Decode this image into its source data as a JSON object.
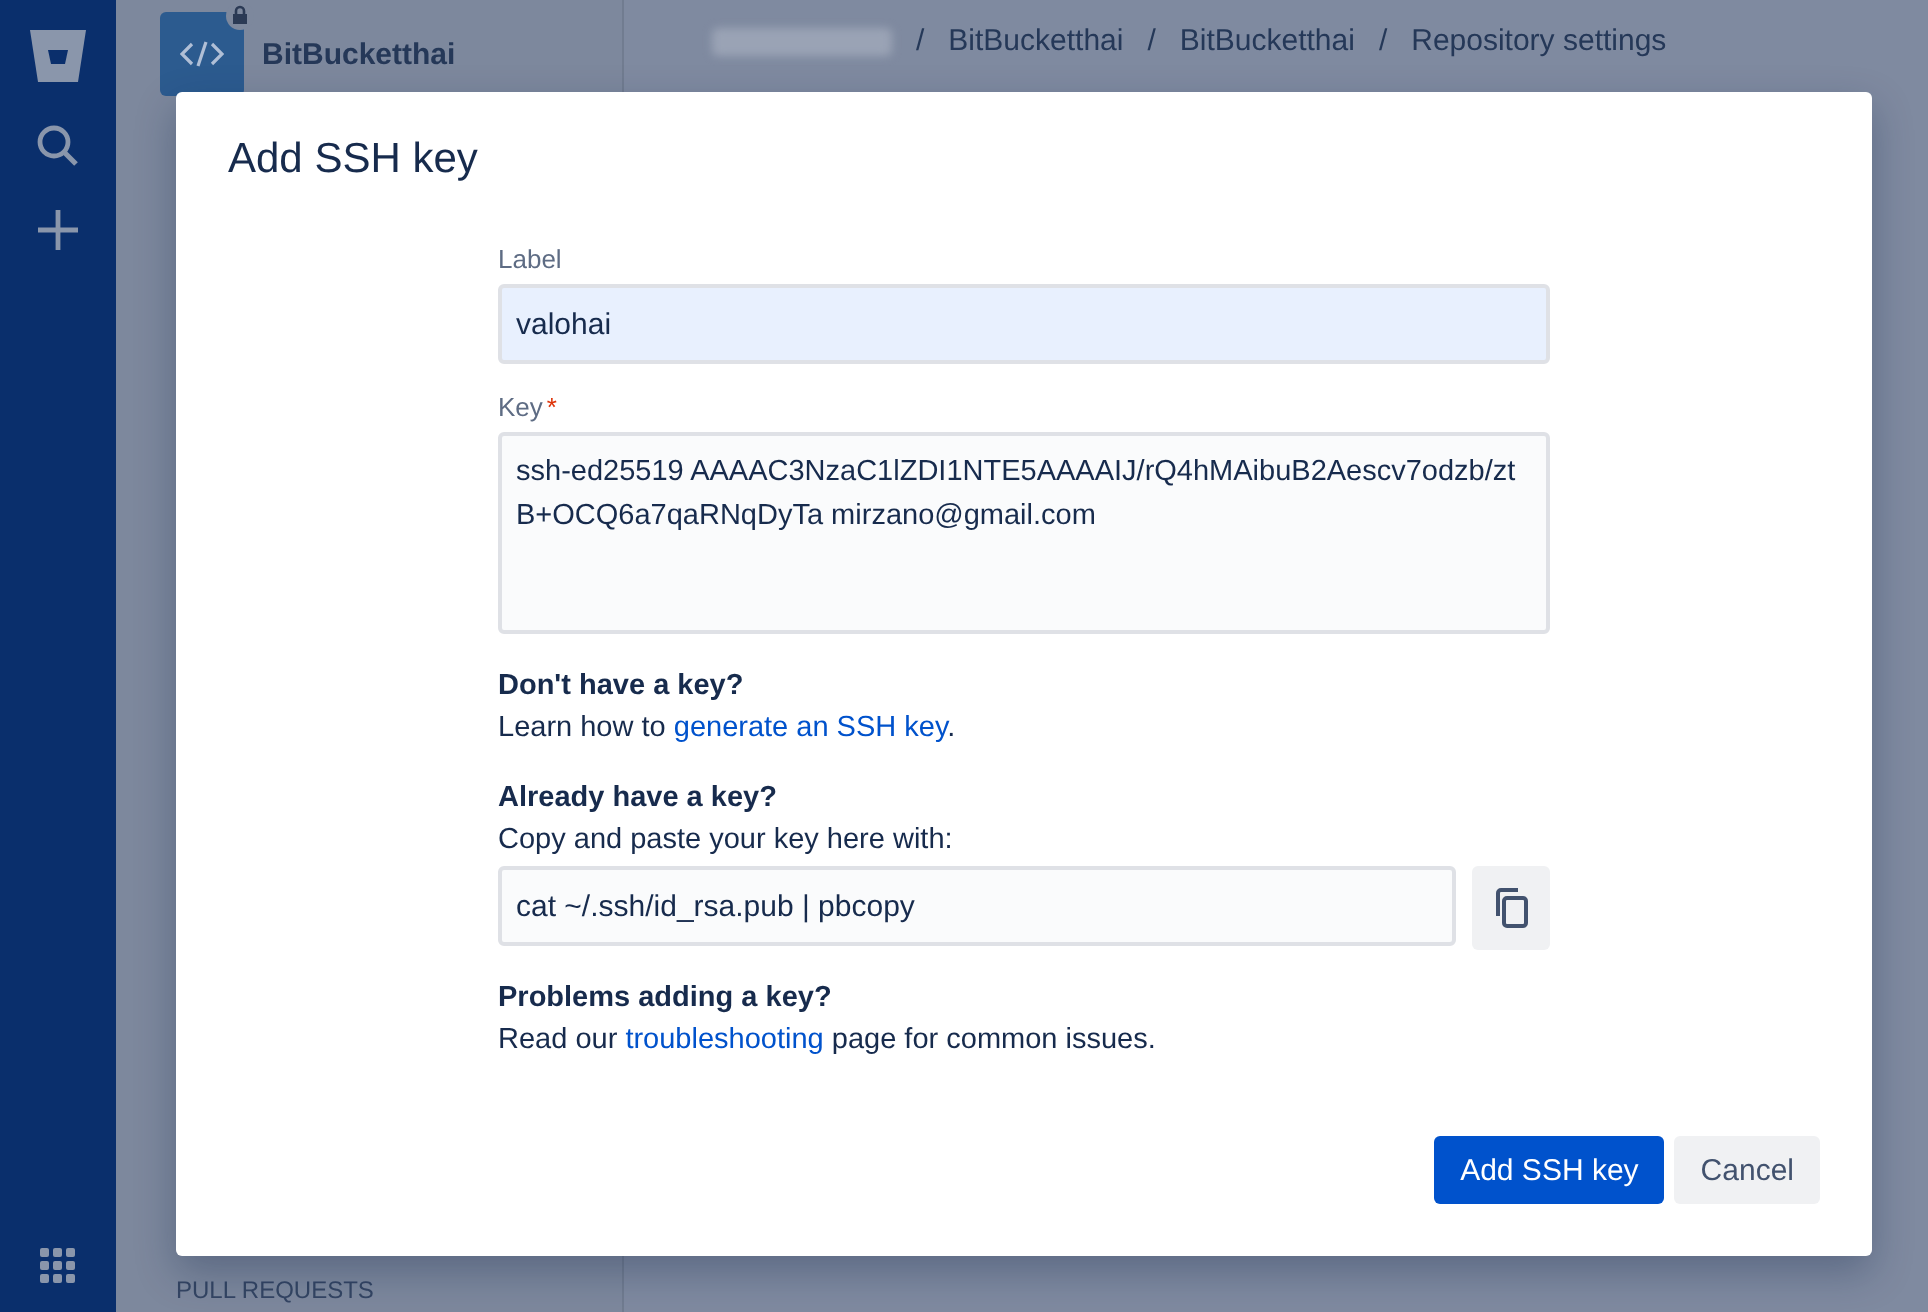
{
  "sidebar": {
    "repository": "BitBucketthai",
    "private": true,
    "section_heading": "PULL REQUESTS"
  },
  "breadcrumbs": [
    {
      "separator": "/",
      "label": "BitBucketthai"
    },
    {
      "separator": "/",
      "label": "BitBucketthai"
    },
    {
      "separator": "/",
      "label": "Repository settings"
    }
  ],
  "modal": {
    "title": "Add SSH key",
    "label_field": {
      "label": "Label",
      "value": "valohai"
    },
    "key_field": {
      "label": "Key",
      "required_marker": "*",
      "value": "ssh-ed25519 AAAAC3NzaC1lZDI1NTE5AAAAIJ/rQ4hMAibuB2Aescv7odzb/ztB+OCQ6a7qaRNqDyTa mirzano@gmail.com"
    },
    "help": [
      {
        "kind": "link",
        "heading": "Don't have a key?",
        "before": "Learn how to ",
        "link": "generate an SSH key",
        "after": "."
      },
      {
        "kind": "command",
        "heading": "Already have a key?",
        "text": "Copy and paste your key here with:",
        "command": "cat ~/.ssh/id_rsa.pub | pbcopy"
      },
      {
        "kind": "link",
        "heading": "Problems adding a key?",
        "before": "Read our ",
        "link": "troubleshooting",
        "after": " page for common issues."
      }
    ],
    "buttons": [
      {
        "label": "Add SSH key",
        "primary": true
      },
      {
        "label": "Cancel",
        "primary": false
      }
    ]
  }
}
